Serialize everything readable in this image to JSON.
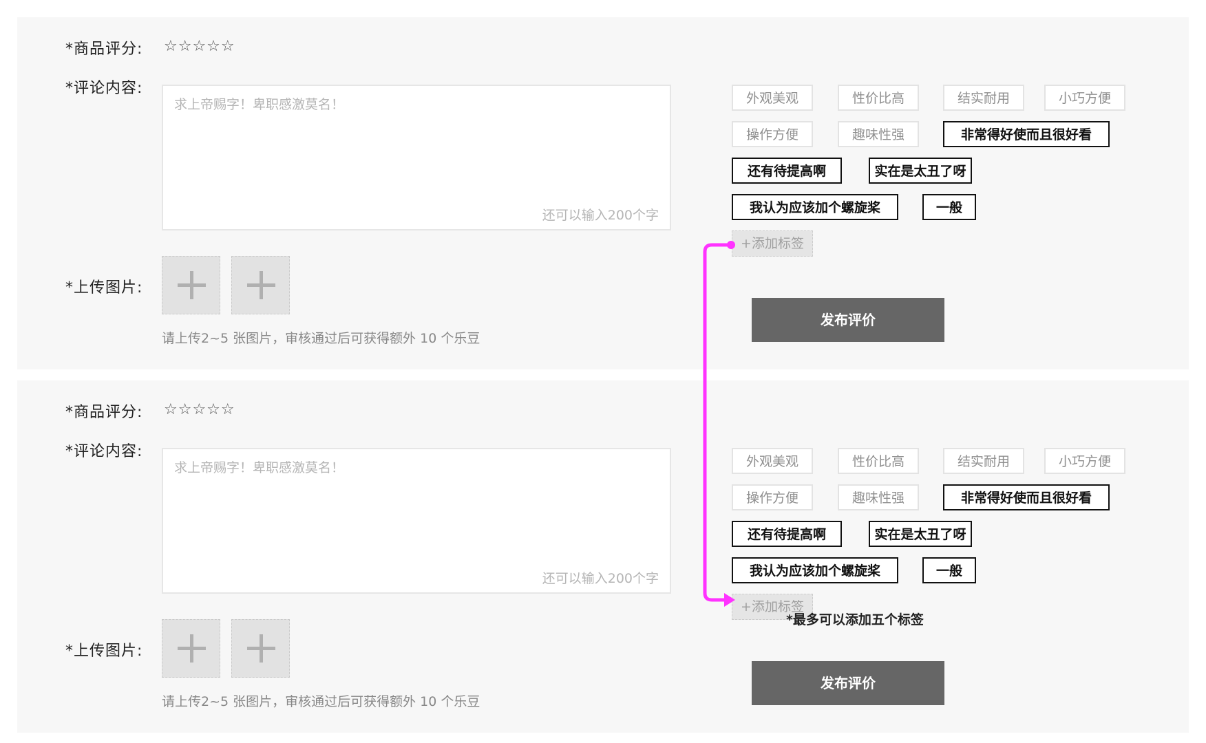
{
  "forms": [
    {
      "rating_label": "*商品评分:",
      "stars": "☆☆☆☆☆",
      "comment_label": "*评论内容:",
      "comment_placeholder": "求上帝赐字！卑职感激莫名！",
      "counter": "还可以输入200个字",
      "upload_label": "*上传图片:",
      "upload_hint": "请上传2~5 张图片，审核通过后可获得额外 10 个乐豆",
      "tags": [
        "外观美观",
        "性价比高",
        "结实耐用",
        "小巧方便",
        "操作方便",
        "趣味性强",
        "非常得好使而且很好看",
        "还有待提高啊",
        "实在是太丑了呀",
        "我认为应该加个螺旋桨",
        "一般"
      ],
      "add_tag": "+添加标签",
      "note": "",
      "publish": "发布评价"
    },
    {
      "rating_label": "*商品评分:",
      "stars": "☆☆☆☆☆",
      "comment_label": "*评论内容:",
      "comment_placeholder": "求上帝赐字！卑职感激莫名！",
      "counter": "还可以输入200个字",
      "upload_label": "*上传图片:",
      "upload_hint": "请上传2~5 张图片，审核通过后可获得额外 10 个乐豆",
      "tags": [
        "外观美观",
        "性价比高",
        "结实耐用",
        "小巧方便",
        "操作方便",
        "趣味性强",
        "非常得好使而且很好看",
        "还有待提高啊",
        "实在是太丑了呀",
        "我认为应该加个螺旋桨",
        "一般"
      ],
      "add_tag": "+添加标签",
      "note": "*最多可以添加五个标签",
      "publish": "发布评价"
    }
  ],
  "colors": {
    "panel_bg": "#f7f7f7",
    "publish_bg": "#666666",
    "connector": "#ff33ff",
    "selected_tag_border": "#111111"
  }
}
